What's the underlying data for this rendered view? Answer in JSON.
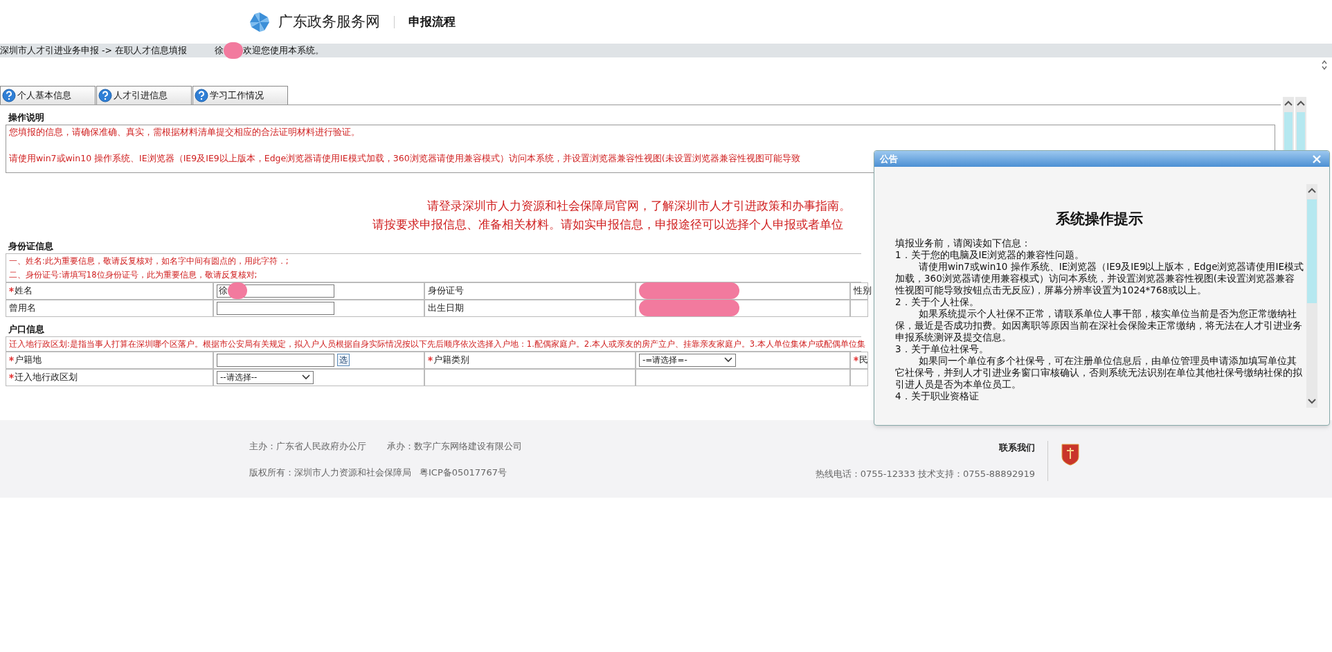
{
  "header": {
    "logo_text": "广东政务服务网",
    "section": "申报流程"
  },
  "breadcrumb": {
    "path": "深圳市人才引进业务申报 -> 在职人才信息填报",
    "user_name": "徐",
    "welcome": "欢迎您使用本系统。"
  },
  "tabs": [
    {
      "label": "个人基本信息"
    },
    {
      "label": "人才引进信息"
    },
    {
      "label": "学习工作情况"
    }
  ],
  "instructions": {
    "title": "操作说明",
    "lines": [
      "您填报的信息，请确保准确、真实，需根据材料清单提交相应的合法证明材料进行验证。",
      "请使用win7或win10 操作系统、IE浏览器（IE9及IE9以上版本，Edge浏览器请使用IE模式加载，360浏览器请使用兼容模式）访问本系统，并设置浏览器兼容性视图(未设置浏览器兼容性视图可能导致"
    ]
  },
  "notice": [
    "请登录深圳市人力资源和社会保障局官网，了解深圳市人才引进政策和办事指南。",
    "请按要求申报信息、准备相关材料。请如实申报信息，申报途径可以选择个人申报或者单位"
  ],
  "sections": [
    {
      "title": "身份证信息",
      "notes": [
        "一、姓名:此为重要信息，敬请反复核对，如名字中间有圆点的，用此字符．;",
        "二、身份证号:请填写18位身份证号，此为重要信息，敬请反复核对;"
      ],
      "rows": [
        [
          {
            "kind": "label",
            "text": "姓名",
            "required": true
          },
          {
            "kind": "input",
            "value": "徐",
            "redacted": true
          },
          {
            "kind": "label",
            "text": "身份证号",
            "required": false
          },
          {
            "kind": "redacted"
          },
          {
            "kind": "label",
            "text": "性别",
            "required": false
          }
        ],
        [
          {
            "kind": "label",
            "text": "曾用名",
            "required": false
          },
          {
            "kind": "input",
            "redacted": false
          },
          {
            "kind": "label",
            "text": "出生日期",
            "required": false
          },
          {
            "kind": "redacted"
          },
          {
            "kind": "empty"
          }
        ]
      ]
    },
    {
      "title": "户口信息",
      "notes": [
        "迁入地行政区划:是指当事人打算在深圳哪个区落户。根据市公安局有关规定，拟入户人员根据自身实际情况按以下先后顺序依次选择入户地：1.配偶家庭户。2.本人或亲友的房产立户、挂靠亲友家庭户。3.本人单位集体户或配偶单位集"
      ],
      "rows": [
        [
          {
            "kind": "label",
            "text": "户籍地",
            "required": true
          },
          {
            "kind": "input_pick",
            "button": "选"
          },
          {
            "kind": "label",
            "text": "户籍类别",
            "required": true
          },
          {
            "kind": "select",
            "value": "-=请选择=-"
          },
          {
            "kind": "label",
            "text": "民",
            "required": true
          }
        ],
        [
          {
            "kind": "label",
            "text": "迁入地行政区划",
            "required": true
          },
          {
            "kind": "select",
            "value": "--请选择--"
          },
          {
            "kind": "empty"
          },
          {
            "kind": "empty"
          },
          {
            "kind": "empty"
          }
        ]
      ]
    }
  ],
  "dialog": {
    "title": "公告",
    "heading": "系统操作提示",
    "intro": "填报业务前，请阅读如下信息：",
    "items": [
      {
        "title": "1．关于您的电脑及IE浏览器的兼容性问题。",
        "detail": "请使用win7或win10 操作系统、IE浏览器（IE9及IE9以上版本，Edge浏览器请使用IE模式加载，360浏览器请使用兼容模式）访问本系统，并设置浏览器兼容性视图(未设置浏览器兼容性视图可能导致按钮点击无反应)，屏幕分辨率设置为1024*768或以上。"
      },
      {
        "title": "2．关于个人社保。",
        "detail": "如果系统提示个人社保不正常，请联系单位人事干部，核实单位当前是否为您正常缴纳社保，最近是否成功扣费。如因离职等原因当前在深社会保险未正常缴纳，将无法在人才引进业务申报系统测评及提交信息。"
      },
      {
        "title": "3．关于单位社保号。",
        "detail": "如果同一个单位有多个社保号，可在注册单位信息后，由单位管理员申请添加填写单位其它社保号，并到人才引进业务窗口审核确认，否则系统无法识别在单位其他社保号缴纳社保的拟引进人员是否为本单位员工。"
      },
      {
        "title": "4．关于职业资格证"
      }
    ]
  },
  "footer": {
    "sponsor": "主办：广东省人民政府办公厅",
    "operator": "承办：数字广东网络建设有限公司",
    "copyright": "版权所有：深圳市人力资源和社会保障局",
    "icp": "粤ICP备05017767号",
    "contact_title": "联系我们",
    "contacts": "热线电话：0755-12333 技术支持：0755-88892919"
  }
}
